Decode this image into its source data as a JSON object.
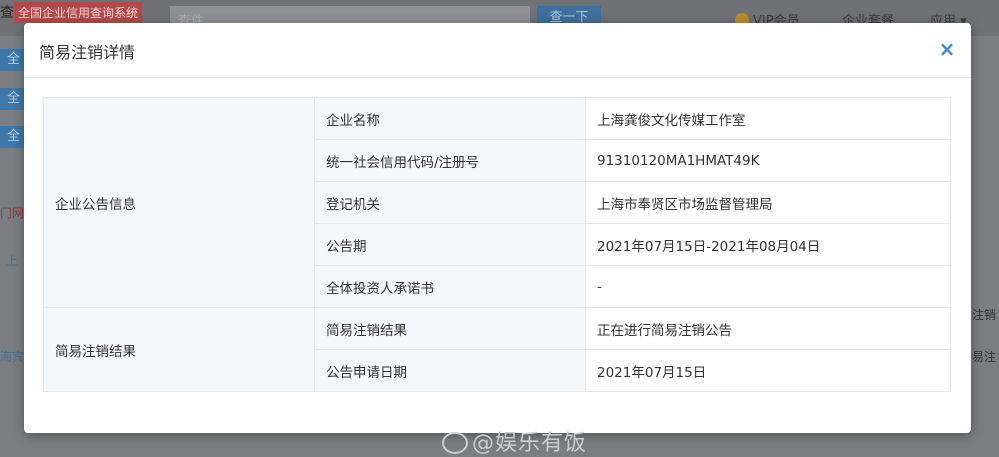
{
  "background": {
    "logo_tag": "全国企业信用查询系统",
    "logo_left": "查",
    "search_placeholder": "查件",
    "search_button": "查一下",
    "vip": "VIP会员",
    "combo": "企业套餐",
    "apps": "应用 ▾",
    "side_tabs": [
      "全",
      "全",
      "全"
    ],
    "left_red": "冂网",
    "left_link": "上",
    "left_link2": "海宾",
    "right_text1": "注销",
    "right_text2": "易注"
  },
  "modal": {
    "title": "简易注销详情",
    "close_symbol": "×",
    "sections": [
      {
        "label": "企业公告信息",
        "rows": [
          {
            "label": "企业名称",
            "value": "上海龚俊文化传媒工作室"
          },
          {
            "label": "统一社会信用代码/注册号",
            "value": "91310120MA1HMAT49K"
          },
          {
            "label": "登记机关",
            "value": "上海市奉贤区市场监督管理局"
          },
          {
            "label": "公告期",
            "value": "2021年07月15日-2021年08月04日"
          },
          {
            "label": "全体投资人承诺书",
            "value": "-"
          }
        ]
      },
      {
        "label": "简易注销结果",
        "rows": [
          {
            "label": "简易注销结果",
            "value": "正在进行简易注销公告"
          },
          {
            "label": "公告申请日期",
            "value": "2021年07月15日"
          }
        ]
      }
    ]
  },
  "watermark": "@娱乐有饭",
  "colors": {
    "link": "#2f7fc3",
    "label_bg": "#f3f8fc",
    "close": "#3a8bd0"
  }
}
